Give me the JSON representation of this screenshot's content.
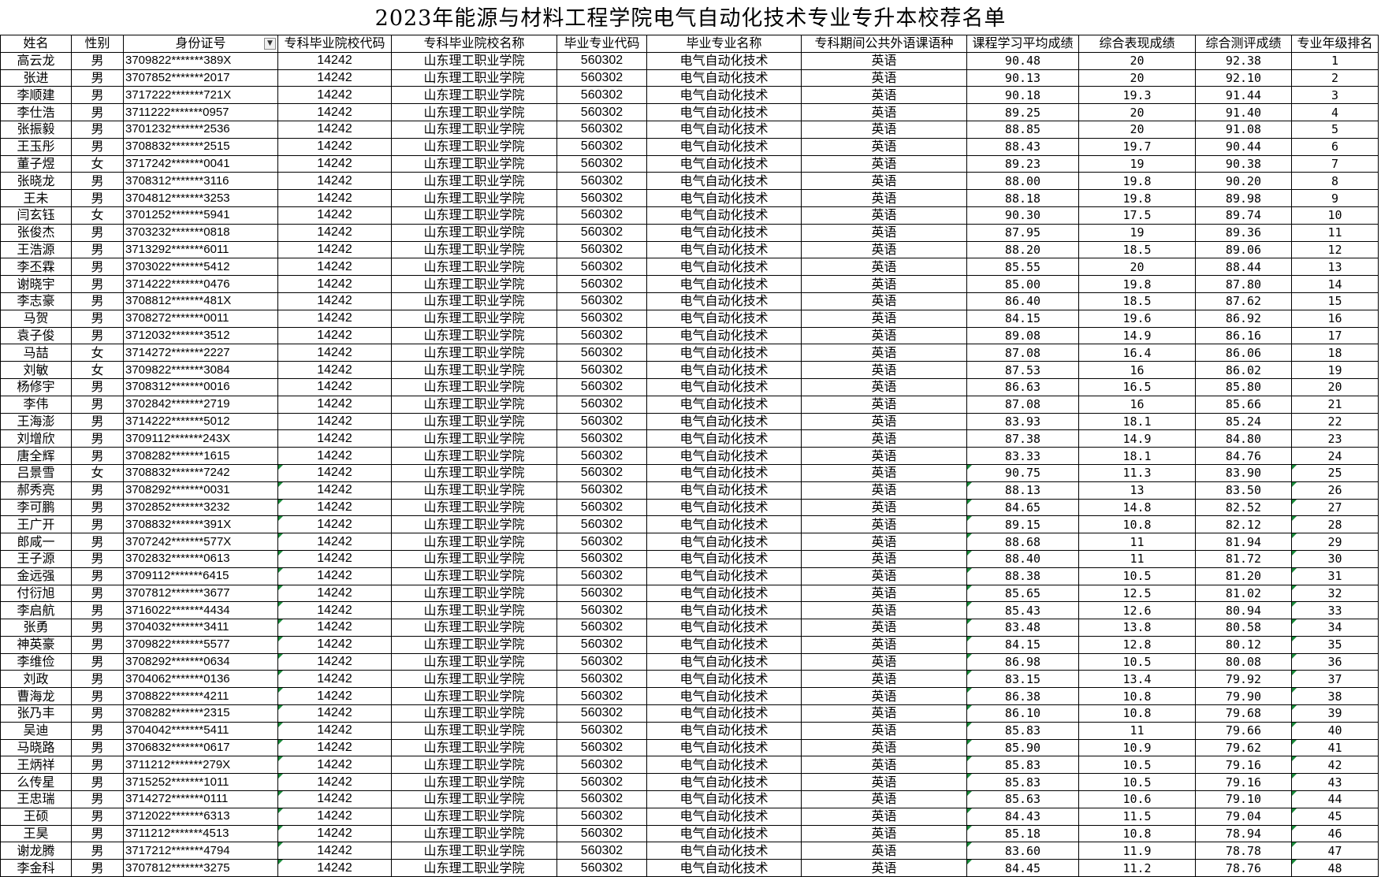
{
  "title": "2023年能源与材料工程学院电气自动化技术专业专升本校荐名单",
  "columns": [
    "姓名",
    "性别",
    "身份证号",
    "专科毕业院校代码",
    "专科毕业院校名称",
    "毕业专业代码",
    "毕业专业名称",
    "专科期间公共外语课语种",
    "课程学习平均成绩",
    "综合表现成绩",
    "综合测评成绩",
    "专业年级排名"
  ],
  "filter_icon": "chevron-down-icon",
  "rows": [
    [
      "高云龙",
      "男",
      "3709822*******389X",
      "14242",
      "山东理工职业学院",
      "560302",
      "电气自动化技术",
      "英语",
      "90.48",
      "20",
      "92.38",
      "1"
    ],
    [
      "张进",
      "男",
      "3707852*******2017",
      "14242",
      "山东理工职业学院",
      "560302",
      "电气自动化技术",
      "英语",
      "90.13",
      "20",
      "92.10",
      "2"
    ],
    [
      "李顺建",
      "男",
      "3717222*******721X",
      "14242",
      "山东理工职业学院",
      "560302",
      "电气自动化技术",
      "英语",
      "90.18",
      "19.3",
      "91.44",
      "3"
    ],
    [
      "李仕浩",
      "男",
      "3711222*******0957",
      "14242",
      "山东理工职业学院",
      "560302",
      "电气自动化技术",
      "英语",
      "89.25",
      "20",
      "91.40",
      "4"
    ],
    [
      "张振毅",
      "男",
      "3701232*******2536",
      "14242",
      "山东理工职业学院",
      "560302",
      "电气自动化技术",
      "英语",
      "88.85",
      "20",
      "91.08",
      "5"
    ],
    [
      "王玉彤",
      "男",
      "3708832*******2515",
      "14242",
      "山东理工职业学院",
      "560302",
      "电气自动化技术",
      "英语",
      "88.43",
      "19.7",
      "90.44",
      "6"
    ],
    [
      "董子煜",
      "女",
      "3717242*******0041",
      "14242",
      "山东理工职业学院",
      "560302",
      "电气自动化技术",
      "英语",
      "89.23",
      "19",
      "90.38",
      "7"
    ],
    [
      "张晓龙",
      "男",
      "3708312*******3116",
      "14242",
      "山东理工职业学院",
      "560302",
      "电气自动化技术",
      "英语",
      "88.00",
      "19.8",
      "90.20",
      "8"
    ],
    [
      "王未",
      "男",
      "3704812*******3253",
      "14242",
      "山东理工职业学院",
      "560302",
      "电气自动化技术",
      "英语",
      "88.18",
      "19.8",
      "89.98",
      "9"
    ],
    [
      "闫玄钰",
      "女",
      "3701252*******5941",
      "14242",
      "山东理工职业学院",
      "560302",
      "电气自动化技术",
      "英语",
      "90.30",
      "17.5",
      "89.74",
      "10"
    ],
    [
      "张俊杰",
      "男",
      "3703232*******0818",
      "14242",
      "山东理工职业学院",
      "560302",
      "电气自动化技术",
      "英语",
      "87.95",
      "19",
      "89.36",
      "11"
    ],
    [
      "王浩源",
      "男",
      "3713292*******6011",
      "14242",
      "山东理工职业学院",
      "560302",
      "电气自动化技术",
      "英语",
      "88.20",
      "18.5",
      "89.06",
      "12"
    ],
    [
      "李丕霖",
      "男",
      "3703022*******5412",
      "14242",
      "山东理工职业学院",
      "560302",
      "电气自动化技术",
      "英语",
      "85.55",
      "20",
      "88.44",
      "13"
    ],
    [
      "谢晓宇",
      "男",
      "3714222*******0476",
      "14242",
      "山东理工职业学院",
      "560302",
      "电气自动化技术",
      "英语",
      "85.00",
      "19.8",
      "87.80",
      "14"
    ],
    [
      "李志豪",
      "男",
      "3708812*******481X",
      "14242",
      "山东理工职业学院",
      "560302",
      "电气自动化技术",
      "英语",
      "86.40",
      "18.5",
      "87.62",
      "15"
    ],
    [
      "马贺",
      "男",
      "3708272*******0011",
      "14242",
      "山东理工职业学院",
      "560302",
      "电气自动化技术",
      "英语",
      "84.15",
      "19.6",
      "86.92",
      "16"
    ],
    [
      "袁子俊",
      "男",
      "3712032*******3512",
      "14242",
      "山东理工职业学院",
      "560302",
      "电气自动化技术",
      "英语",
      "89.08",
      "14.9",
      "86.16",
      "17"
    ],
    [
      "马喆",
      "女",
      "3714272*******2227",
      "14242",
      "山东理工职业学院",
      "560302",
      "电气自动化技术",
      "英语",
      "87.08",
      "16.4",
      "86.06",
      "18"
    ],
    [
      "刘敏",
      "女",
      "3709822*******3084",
      "14242",
      "山东理工职业学院",
      "560302",
      "电气自动化技术",
      "英语",
      "87.53",
      "16",
      "86.02",
      "19"
    ],
    [
      "杨修宇",
      "男",
      "3708312*******0016",
      "14242",
      "山东理工职业学院",
      "560302",
      "电气自动化技术",
      "英语",
      "86.63",
      "16.5",
      "85.80",
      "20"
    ],
    [
      "李伟",
      "男",
      "3702842*******2719",
      "14242",
      "山东理工职业学院",
      "560302",
      "电气自动化技术",
      "英语",
      "87.08",
      "16",
      "85.66",
      "21"
    ],
    [
      "王海澎",
      "男",
      "3714222*******5012",
      "14242",
      "山东理工职业学院",
      "560302",
      "电气自动化技术",
      "英语",
      "83.93",
      "18.1",
      "85.24",
      "22"
    ],
    [
      "刘增欣",
      "男",
      "3709112*******243X",
      "14242",
      "山东理工职业学院",
      "560302",
      "电气自动化技术",
      "英语",
      "87.38",
      "14.9",
      "84.80",
      "23"
    ],
    [
      "唐全辉",
      "男",
      "3708282*******1615",
      "14242",
      "山东理工职业学院",
      "560302",
      "电气自动化技术",
      "英语",
      "83.33",
      "18.1",
      "84.76",
      "24"
    ],
    [
      "吕景雪",
      "女",
      "3708832*******7242",
      "14242",
      "山东理工职业学院",
      "560302",
      "电气自动化技术",
      "英语",
      "90.75",
      "11.3",
      "83.90",
      "25"
    ],
    [
      "郝秀亮",
      "男",
      "3708292*******0031",
      "14242",
      "山东理工职业学院",
      "560302",
      "电气自动化技术",
      "英语",
      "88.13",
      "13",
      "83.50",
      "26"
    ],
    [
      "李可鹏",
      "男",
      "3702852*******3232",
      "14242",
      "山东理工职业学院",
      "560302",
      "电气自动化技术",
      "英语",
      "84.65",
      "14.8",
      "82.52",
      "27"
    ],
    [
      "王广开",
      "男",
      "3708832*******391X",
      "14242",
      "山东理工职业学院",
      "560302",
      "电气自动化技术",
      "英语",
      "89.15",
      "10.8",
      "82.12",
      "28"
    ],
    [
      "郎咸一",
      "男",
      "3707242*******577X",
      "14242",
      "山东理工职业学院",
      "560302",
      "电气自动化技术",
      "英语",
      "88.68",
      "11",
      "81.94",
      "29"
    ],
    [
      "王子源",
      "男",
      "3702832*******0613",
      "14242",
      "山东理工职业学院",
      "560302",
      "电气自动化技术",
      "英语",
      "88.40",
      "11",
      "81.72",
      "30"
    ],
    [
      "金远强",
      "男",
      "3709112*******6415",
      "14242",
      "山东理工职业学院",
      "560302",
      "电气自动化技术",
      "英语",
      "88.38",
      "10.5",
      "81.20",
      "31"
    ],
    [
      "付衍旭",
      "男",
      "3707812*******3677",
      "14242",
      "山东理工职业学院",
      "560302",
      "电气自动化技术",
      "英语",
      "85.65",
      "12.5",
      "81.02",
      "32"
    ],
    [
      "李启航",
      "男",
      "3716022*******4434",
      "14242",
      "山东理工职业学院",
      "560302",
      "电气自动化技术",
      "英语",
      "85.43",
      "12.6",
      "80.94",
      "33"
    ],
    [
      "张勇",
      "男",
      "3704032*******3411",
      "14242",
      "山东理工职业学院",
      "560302",
      "电气自动化技术",
      "英语",
      "83.48",
      "13.8",
      "80.58",
      "34"
    ],
    [
      "神英豪",
      "男",
      "3709822*******5577",
      "14242",
      "山东理工职业学院",
      "560302",
      "电气自动化技术",
      "英语",
      "84.15",
      "12.8",
      "80.12",
      "35"
    ],
    [
      "李维俭",
      "男",
      "3708292*******0634",
      "14242",
      "山东理工职业学院",
      "560302",
      "电气自动化技术",
      "英语",
      "86.98",
      "10.5",
      "80.08",
      "36"
    ],
    [
      "刘政",
      "男",
      "3704062*******0136",
      "14242",
      "山东理工职业学院",
      "560302",
      "电气自动化技术",
      "英语",
      "83.15",
      "13.4",
      "79.92",
      "37"
    ],
    [
      "曹海龙",
      "男",
      "3708822*******4211",
      "14242",
      "山东理工职业学院",
      "560302",
      "电气自动化技术",
      "英语",
      "86.38",
      "10.8",
      "79.90",
      "38"
    ],
    [
      "张乃丰",
      "男",
      "3708282*******2315",
      "14242",
      "山东理工职业学院",
      "560302",
      "电气自动化技术",
      "英语",
      "86.10",
      "10.8",
      "79.68",
      "39"
    ],
    [
      "吴迪",
      "男",
      "3704042*******5411",
      "14242",
      "山东理工职业学院",
      "560302",
      "电气自动化技术",
      "英语",
      "85.83",
      "11",
      "79.66",
      "40"
    ],
    [
      "马晓路",
      "男",
      "3706832*******0617",
      "14242",
      "山东理工职业学院",
      "560302",
      "电气自动化技术",
      "英语",
      "85.90",
      "10.9",
      "79.62",
      "41"
    ],
    [
      "王炳祥",
      "男",
      "3711212*******279X",
      "14242",
      "山东理工职业学院",
      "560302",
      "电气自动化技术",
      "英语",
      "85.83",
      "10.5",
      "79.16",
      "42"
    ],
    [
      "么传星",
      "男",
      "3715252*******1011",
      "14242",
      "山东理工职业学院",
      "560302",
      "电气自动化技术",
      "英语",
      "85.83",
      "10.5",
      "79.16",
      "43"
    ],
    [
      "王忠瑞",
      "男",
      "3714272*******0111",
      "14242",
      "山东理工职业学院",
      "560302",
      "电气自动化技术",
      "英语",
      "85.63",
      "10.6",
      "79.10",
      "44"
    ],
    [
      "王硕",
      "男",
      "3712022*******6313",
      "14242",
      "山东理工职业学院",
      "560302",
      "电气自动化技术",
      "英语",
      "84.43",
      "11.5",
      "79.04",
      "45"
    ],
    [
      "王昊",
      "男",
      "3711212*******4513",
      "14242",
      "山东理工职业学院",
      "560302",
      "电气自动化技术",
      "英语",
      "85.18",
      "10.8",
      "78.94",
      "46"
    ],
    [
      "谢龙腾",
      "男",
      "3717212*******4794",
      "14242",
      "山东理工职业学院",
      "560302",
      "电气自动化技术",
      "英语",
      "83.60",
      "11.9",
      "78.78",
      "47"
    ],
    [
      "李金科",
      "男",
      "3707812*******3275",
      "14242",
      "山东理工职业学院",
      "560302",
      "电气自动化技术",
      "英语",
      "84.45",
      "11.2",
      "78.76",
      "48"
    ]
  ]
}
